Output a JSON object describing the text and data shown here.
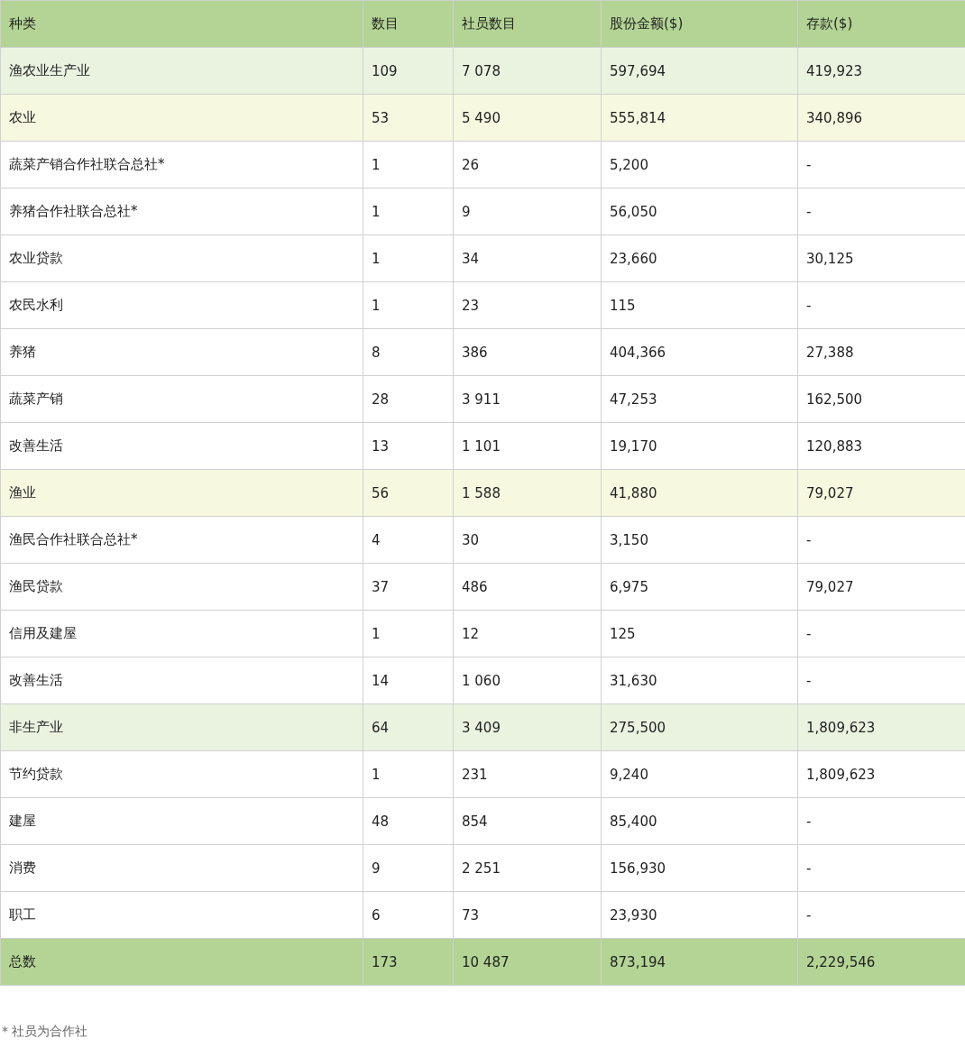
{
  "table": {
    "columns": [
      "种类",
      "数目",
      "社员数目",
      "股份金额($)",
      "存款($)"
    ],
    "rows": [
      {
        "kind": "sector",
        "cells": [
          "渔农业生产业",
          "109",
          "7 078",
          "597,694",
          "419,923"
        ]
      },
      {
        "kind": "group",
        "cells": [
          "农业",
          "53",
          "5 490",
          "555,814",
          "340,896"
        ]
      },
      {
        "kind": "item",
        "cells": [
          "蔬菜产销合作社联合总社*",
          "1",
          "26",
          "5,200",
          "-"
        ]
      },
      {
        "kind": "item",
        "cells": [
          "养猪合作社联合总社*",
          "1",
          "9",
          "56,050",
          "-"
        ]
      },
      {
        "kind": "item",
        "cells": [
          "农业贷款",
          "1",
          "34",
          "23,660",
          "30,125"
        ]
      },
      {
        "kind": "item",
        "cells": [
          "农民水利",
          "1",
          "23",
          "115",
          "-"
        ]
      },
      {
        "kind": "item",
        "cells": [
          "养猪",
          "8",
          "386",
          "404,366",
          "27,388"
        ]
      },
      {
        "kind": "item",
        "cells": [
          "蔬菜产销",
          "28",
          "3 911",
          "47,253",
          "162,500"
        ]
      },
      {
        "kind": "item",
        "cells": [
          "改善生活",
          "13",
          "1 101",
          "19,170",
          "120,883"
        ]
      },
      {
        "kind": "group",
        "cells": [
          "渔业",
          "56",
          "1 588",
          "41,880",
          "79,027"
        ]
      },
      {
        "kind": "item",
        "cells": [
          "渔民合作社联合总社*",
          "4",
          "30",
          "3,150",
          "-"
        ]
      },
      {
        "kind": "item",
        "cells": [
          "渔民贷款",
          "37",
          "486",
          "6,975",
          "79,027"
        ]
      },
      {
        "kind": "item",
        "cells": [
          "信用及建屋",
          "1",
          "12",
          "125",
          "-"
        ]
      },
      {
        "kind": "item",
        "cells": [
          "改善生活",
          "14",
          "1 060",
          "31,630",
          "-"
        ]
      },
      {
        "kind": "sector",
        "cells": [
          "非生产业",
          "64",
          "3 409",
          "275,500",
          "1,809,623"
        ]
      },
      {
        "kind": "item",
        "cells": [
          "节约贷款",
          "1",
          "231",
          "9,240",
          "1,809,623"
        ]
      },
      {
        "kind": "item",
        "cells": [
          "建屋",
          "48",
          "854",
          "85,400",
          "-"
        ]
      },
      {
        "kind": "item",
        "cells": [
          "消费",
          "9",
          "2 251",
          "156,930",
          "-"
        ]
      },
      {
        "kind": "item",
        "cells": [
          "职工",
          "6",
          "73",
          "23,930",
          "-"
        ]
      },
      {
        "kind": "total",
        "cells": [
          "总数",
          "173",
          "10 487",
          "873,194",
          "2,229,546"
        ]
      }
    ]
  },
  "footnote": "* 社员为合作社"
}
